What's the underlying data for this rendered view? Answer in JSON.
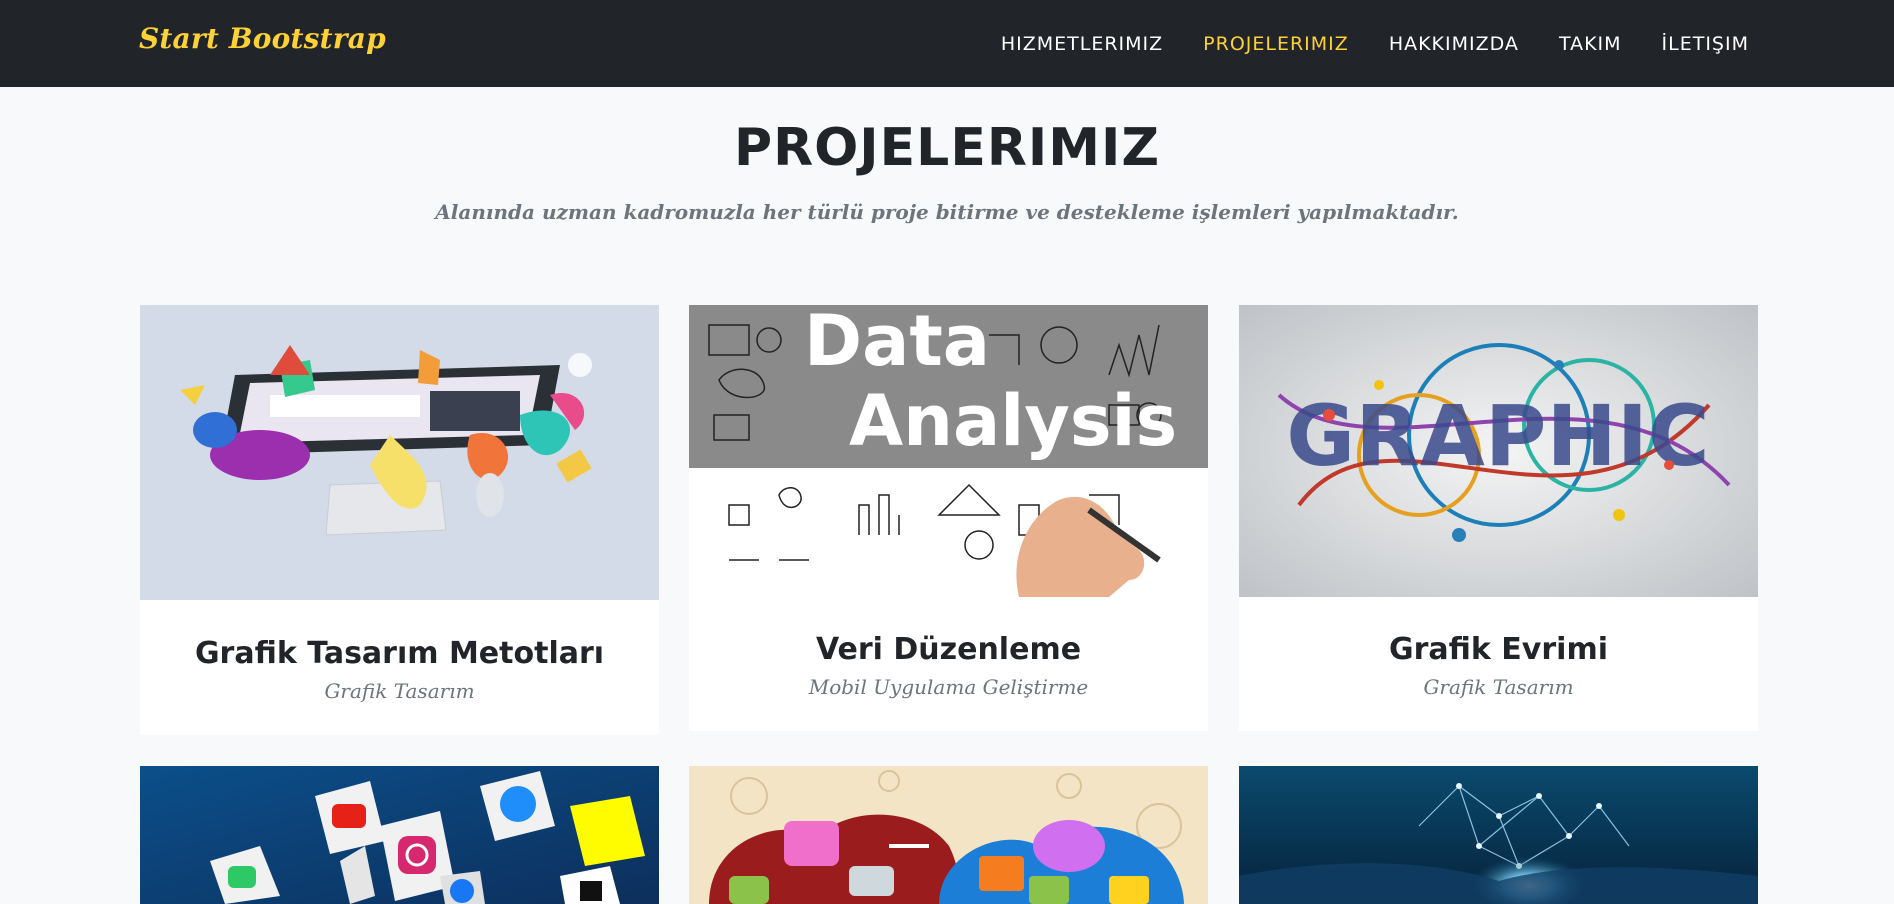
{
  "navbar": {
    "brand": "Start Bootstrap",
    "links": [
      {
        "label": "HIZMETLERIMIZ",
        "active": false
      },
      {
        "label": "PROJELERIMIZ",
        "active": true
      },
      {
        "label": "HAKKIMIZDA",
        "active": false
      },
      {
        "label": "TAKIM",
        "active": false
      },
      {
        "label": "İLETIŞIM",
        "active": false
      }
    ]
  },
  "portfolio": {
    "heading": "PROJELERIMIZ",
    "subheading": "Alanında uzman kadromuzla her türlü proje bitirme ve destekleme işlemleri yapılmaktadır.",
    "items": [
      {
        "title": "Grafik Tasarım Metotları",
        "subtitle": "Grafik Tasarım",
        "image": "desktop-design-illustration"
      },
      {
        "title": "Veri Düzenleme",
        "subtitle": "Mobil Uygulama Geliştirme",
        "image": "data-analysis-sketch",
        "image_text": [
          "Data",
          "Analysis"
        ]
      },
      {
        "title": "Grafik Evrimi",
        "subtitle": "Grafik Tasarım",
        "image": "graphic-typography-art",
        "image_text": "GRAPHIC"
      },
      {
        "title": "",
        "subtitle": "",
        "image": "social-media-cubes"
      },
      {
        "title": "",
        "subtitle": "",
        "image": "chat-bubbles-cloud"
      },
      {
        "title": "",
        "subtitle": "",
        "image": "network-globe"
      }
    ]
  },
  "colors": {
    "navbar_bg": "#212529",
    "accent": "#fed136",
    "page_bg": "#f8f9fa",
    "heading": "#212529",
    "muted": "#6c757d"
  }
}
